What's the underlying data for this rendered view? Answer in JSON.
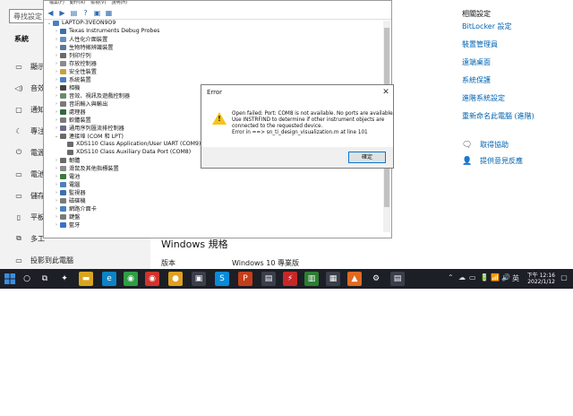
{
  "settings": {
    "search_placeholder": "尋找設定",
    "section_heading": "系統",
    "nav_items": [
      {
        "icon": "display-icon",
        "glyph": "▭",
        "label": "顯示"
      },
      {
        "icon": "sound-icon",
        "glyph": "◁)",
        "label": "音效"
      },
      {
        "icon": "notification-icon",
        "glyph": "▢",
        "label": "通知"
      },
      {
        "icon": "focus-assist-icon",
        "glyph": "☾",
        "label": "專注"
      },
      {
        "icon": "power-icon",
        "glyph": "⏻",
        "label": "電源"
      },
      {
        "icon": "battery-icon",
        "glyph": "▭",
        "label": "電池"
      },
      {
        "icon": "storage-icon",
        "glyph": "▭",
        "label": "儲存"
      },
      {
        "icon": "tablet-icon",
        "glyph": "▯",
        "label": "平板"
      },
      {
        "icon": "multitask-icon",
        "glyph": "⧉",
        "label": "多工"
      },
      {
        "icon": "project-icon",
        "glyph": "▭",
        "label": "投影到此電腦"
      }
    ],
    "windows_spec_heading": "Windows 規格",
    "spec_label": "版本",
    "spec_value": "Windows 10 專業版",
    "related_heading": "相關設定",
    "related_links": [
      "BitLocker 設定",
      "裝置管理員",
      "遠端桌面",
      "系統保護",
      "進階系統設定",
      "重新命名此電腦 (進階)"
    ],
    "help_items": [
      {
        "icon": "help-icon",
        "glyph": "🗨",
        "label": "取得協助"
      },
      {
        "icon": "feedback-icon",
        "glyph": "👤",
        "label": "提供意見反應"
      }
    ]
  },
  "device_manager": {
    "menu": [
      "檔案(F)",
      "動作(A)",
      "檢視(V)",
      "說明(H)"
    ],
    "tree": [
      {
        "indent": 0,
        "toggle": "⌄",
        "color": "#4a7fc1",
        "label": "LAPTOP-3VEON9O9"
      },
      {
        "indent": 1,
        "toggle": "›",
        "color": "#3a6fb0",
        "label": "Texas Instruments Debug Probes"
      },
      {
        "indent": 1,
        "toggle": "›",
        "color": "#6a8fb8",
        "label": "人性化介面裝置"
      },
      {
        "indent": 1,
        "toggle": "›",
        "color": "#5a7a9a",
        "label": "生物特徵辨識裝置"
      },
      {
        "indent": 1,
        "toggle": "›",
        "color": "#6a6a6a",
        "label": "列印佇列"
      },
      {
        "indent": 1,
        "toggle": "›",
        "color": "#8a8a8a",
        "label": "存放控制器"
      },
      {
        "indent": 1,
        "toggle": "›",
        "color": "#c8a040",
        "label": "安全性裝置"
      },
      {
        "indent": 1,
        "toggle": "›",
        "color": "#4a7fc1",
        "label": "系統裝置"
      },
      {
        "indent": 1,
        "toggle": "›",
        "color": "#444444",
        "label": "相機"
      },
      {
        "indent": 1,
        "toggle": "›",
        "color": "#6a8a6a",
        "label": "音效、視訊及遊戲控制器"
      },
      {
        "indent": 1,
        "toggle": "›",
        "color": "#7a7a7a",
        "label": "音訊輸入與輸出"
      },
      {
        "indent": 1,
        "toggle": "›",
        "color": "#2e6a3a",
        "label": "處理器"
      },
      {
        "indent": 1,
        "toggle": "›",
        "color": "#7a7a7a",
        "label": "軟體裝置"
      },
      {
        "indent": 1,
        "toggle": "›",
        "color": "#6a6a8a",
        "label": "通用序列匯流排控制器"
      },
      {
        "indent": 1,
        "toggle": "⌄",
        "color": "#6a6a6a",
        "label": "連接埠 (COM 和 LPT)"
      },
      {
        "indent": 2,
        "toggle": "",
        "color": "#6a6a6a",
        "label": "XDS110 Class Application/User UART (COM9)"
      },
      {
        "indent": 2,
        "toggle": "",
        "color": "#6a6a6a",
        "label": "XDS110 Class Auxiliary Data Port (COM8)"
      },
      {
        "indent": 1,
        "toggle": "›",
        "color": "#6a6a6a",
        "label": "韌體"
      },
      {
        "indent": 1,
        "toggle": "›",
        "color": "#8a8a8a",
        "label": "滑鼠及其他指標裝置"
      },
      {
        "indent": 1,
        "toggle": "›",
        "color": "#3a7a3a",
        "label": "電池"
      },
      {
        "indent": 1,
        "toggle": "›",
        "color": "#4a7fc1",
        "label": "電腦"
      },
      {
        "indent": 1,
        "toggle": "›",
        "color": "#3a6fb0",
        "label": "監視器"
      },
      {
        "indent": 1,
        "toggle": "›",
        "color": "#7a7a7a",
        "label": "磁碟機"
      },
      {
        "indent": 1,
        "toggle": "›",
        "color": "#4a7fc1",
        "label": "網路介面卡"
      },
      {
        "indent": 1,
        "toggle": "›",
        "color": "#7a7a7a",
        "label": "鍵盤"
      },
      {
        "indent": 1,
        "toggle": "›",
        "color": "#3a6fd0",
        "label": "藍牙"
      }
    ]
  },
  "error_dialog": {
    "title": "Error",
    "lines": [
      "Open failed: Port: COM8 is not available. No ports are available.",
      "Use INSTRFIND to determine if other instrument objects are",
      "connected to the requested device.",
      "Error in ==> sn_ti_design_visualization.m at line 101"
    ],
    "ok_label": "確定"
  },
  "taskbar": {
    "apps": [
      {
        "name": "search-taskbar-icon",
        "glyph": "○",
        "color": "#1c1f26"
      },
      {
        "name": "task-view-icon",
        "glyph": "⧉",
        "color": "#1c1f26"
      },
      {
        "name": "app-icon-1",
        "glyph": "✦",
        "color": "#1c1f26"
      },
      {
        "name": "file-explorer-icon",
        "glyph": "▬",
        "color": "#d9a520"
      },
      {
        "name": "edge-icon",
        "glyph": "e",
        "color": "#0b84c6"
      },
      {
        "name": "chrome-icon",
        "glyph": "◉",
        "color": "#2f9e44"
      },
      {
        "name": "app-icon-red",
        "glyph": "◉",
        "color": "#d0342c"
      },
      {
        "name": "app-icon-yellow",
        "glyph": "●",
        "color": "#e0a020"
      },
      {
        "name": "app-icon-box",
        "glyph": "▣",
        "color": "#3a3f4a"
      },
      {
        "name": "skype-icon",
        "glyph": "S",
        "color": "#0a8ad8"
      },
      {
        "name": "powerpoint-icon",
        "glyph": "P",
        "color": "#c43e1c"
      },
      {
        "name": "app-icon-2",
        "glyph": "▤",
        "color": "#3a3f4a"
      },
      {
        "name": "app-icon-bolt",
        "glyph": "⚡",
        "color": "#c62828"
      },
      {
        "name": "app-icon-3",
        "glyph": "▥",
        "color": "#2e7d32"
      },
      {
        "name": "app-icon-4",
        "glyph": "▦",
        "color": "#3a3f4a"
      },
      {
        "name": "matlab-icon",
        "glyph": "▲",
        "color": "#e06a20"
      },
      {
        "name": "settings-taskbar-icon",
        "glyph": "⚙",
        "color": "#1c1f26"
      },
      {
        "name": "app-icon-5",
        "glyph": "▤",
        "color": "#3a3f4a"
      }
    ],
    "tray": [
      "⌃",
      "☁",
      "▭",
      "🔋",
      "📶",
      "🔊",
      "英",
      "▦"
    ],
    "time": "下午 12:16",
    "date": "2022/1/12"
  }
}
